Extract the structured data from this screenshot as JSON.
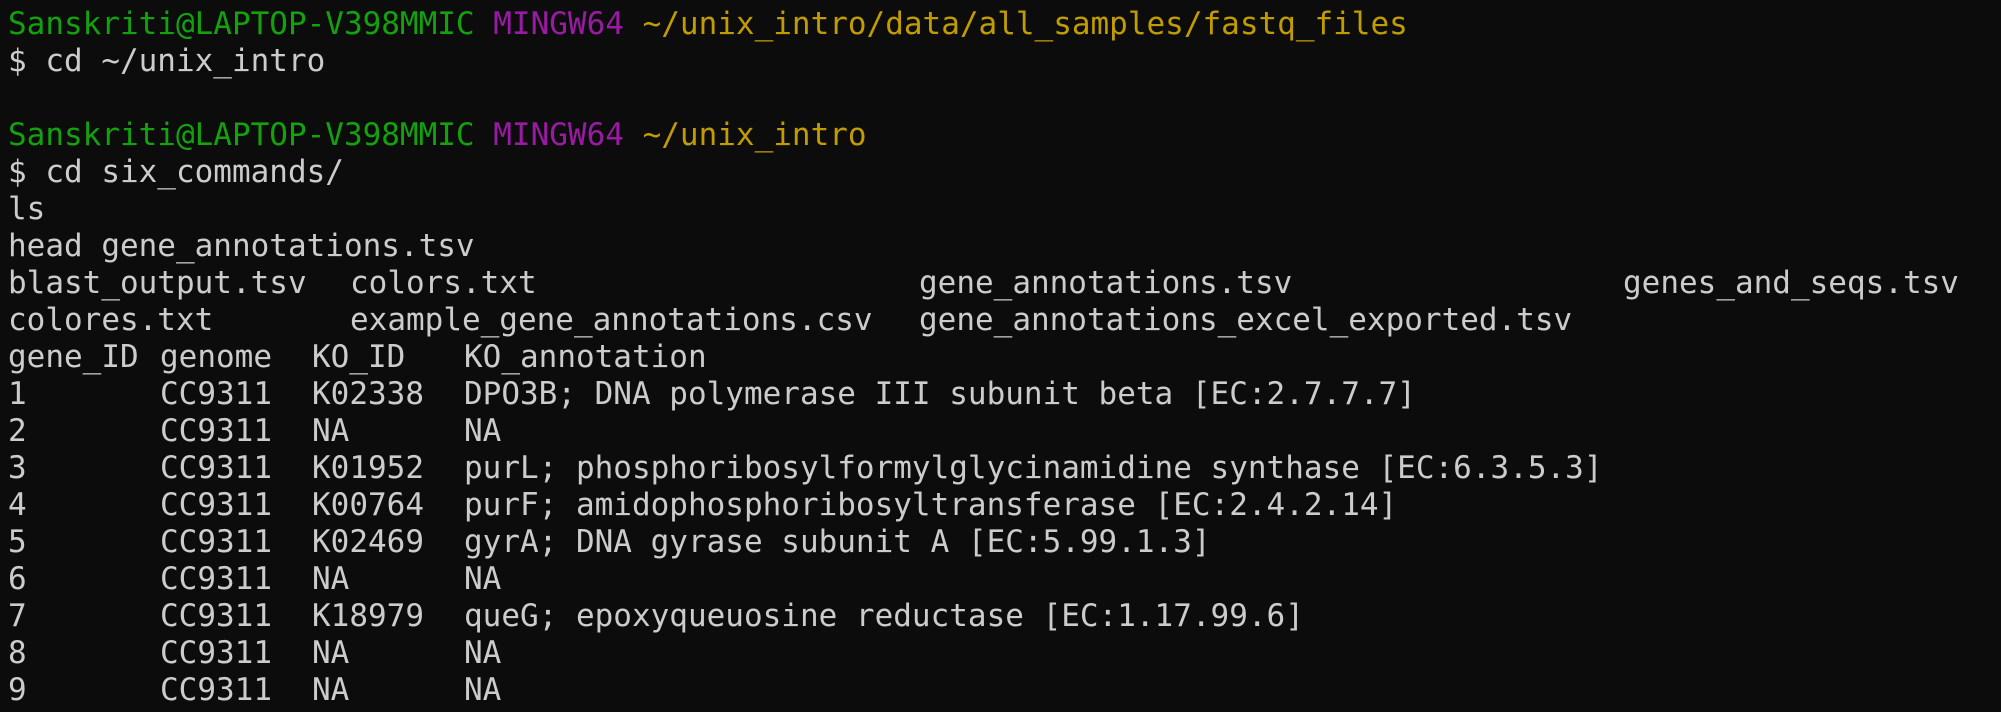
{
  "prompts": [
    {
      "user": "Sanskriti@LAPTOP-V398MMIC",
      "env": "MINGW64",
      "path": "~/unix_intro/data/all_samples/fastq_files",
      "command": "$ cd ~/unix_intro"
    },
    {
      "user": "Sanskriti@LAPTOP-V398MMIC",
      "env": "MINGW64",
      "path": "~/unix_intro",
      "command": "$ cd six_commands/"
    }
  ],
  "typed_lines": [
    "ls",
    "head gene_annotations.tsv"
  ],
  "ls_output": [
    [
      "blast_output.tsv",
      "colors.txt",
      "gene_annotations.tsv",
      "genes_and_seqs.tsv"
    ],
    [
      "colores.txt",
      "example_gene_annotations.csv",
      "gene_annotations_excel_exported.tsv",
      ""
    ]
  ],
  "table": {
    "headers": [
      "gene_ID",
      "genome",
      "KO_ID",
      "KO_annotation"
    ],
    "rows": [
      [
        "1",
        "CC9311",
        "K02338",
        "DPO3B; DNA polymerase III subunit beta [EC:2.7.7.7]"
      ],
      [
        "2",
        "CC9311",
        "NA",
        "NA"
      ],
      [
        "3",
        "CC9311",
        "K01952",
        "purL; phosphoribosylformylglycinamidine synthase [EC:6.3.5.3]"
      ],
      [
        "4",
        "CC9311",
        "K00764",
        "purF; amidophosphoribosyltransferase [EC:2.4.2.14]"
      ],
      [
        "5",
        "CC9311",
        "K02469",
        "gyrA; DNA gyrase subunit A [EC:5.99.1.3]"
      ],
      [
        "6",
        "CC9311",
        "NA",
        "NA"
      ],
      [
        "7",
        "CC9311",
        "K18979",
        "queG; epoxyqueuosine reductase [EC:1.17.99.6]"
      ],
      [
        "8",
        "CC9311",
        "NA",
        "NA"
      ],
      [
        "9",
        "CC9311",
        "NA",
        "NA"
      ]
    ]
  },
  "colors": {
    "background": "#0c0c0c",
    "foreground": "#cccccc",
    "user": "#13a10e",
    "env": "#9a1aa3",
    "path": "#c19c00"
  }
}
